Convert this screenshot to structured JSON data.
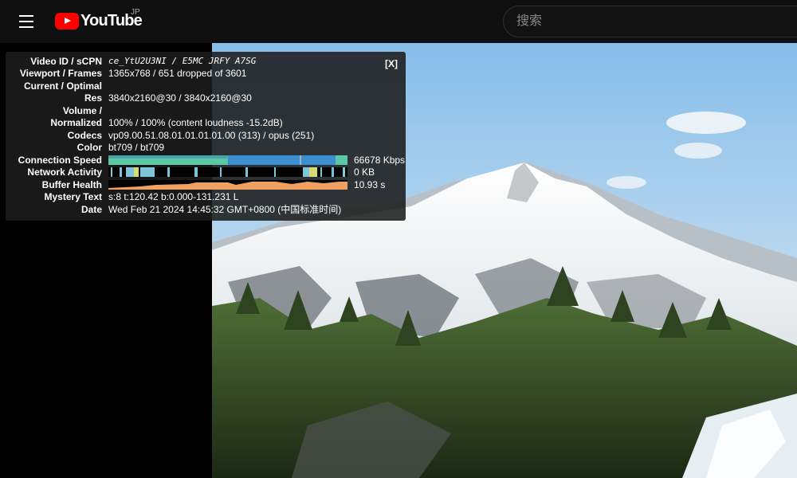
{
  "header": {
    "logo_text": "YouTube",
    "country_code": "JP",
    "search_placeholder": "搜索"
  },
  "stats": {
    "close_label": "[X]",
    "rows": {
      "video_id": {
        "label": "Video ID / sCPN",
        "value": "ce_YtU2U3NI / E5MC JRFY A7SG"
      },
      "viewport": {
        "label": "Viewport / Frames",
        "value": "1365x768 / 651 dropped of 3601"
      },
      "current_optimal": {
        "label": "Current / Optimal",
        "value": ""
      },
      "res": {
        "label": "Res",
        "value": "3840x2160@30 / 3840x2160@30"
      },
      "volume": {
        "label": "Volume /",
        "value": ""
      },
      "normalized": {
        "label": "Normalized",
        "value": "100% / 100% (content loudness -15.2dB)"
      },
      "codecs": {
        "label": "Codecs",
        "value": "vp09.00.51.08.01.01.01.01.00 (313) / opus (251)"
      },
      "color": {
        "label": "Color",
        "value": "bt709 / bt709"
      },
      "connection_speed": {
        "label": "Connection Speed",
        "value": "66678 Kbps"
      },
      "network_activity": {
        "label": "Network Activity",
        "value": "0 KB"
      },
      "buffer_health": {
        "label": "Buffer Health",
        "value": "10.93 s"
      },
      "mystery_text": {
        "label": "Mystery Text",
        "value": "s:8 t:120.42 b:0.000-131.231 L"
      },
      "date": {
        "label": "Date",
        "value": "Wed Feb 21 2024 14:45:32 GMT+0800 (中国标准时间)"
      }
    },
    "colors": {
      "connection_speed": "#3d8ed0",
      "connection_speed_alt": "#5cc7a4",
      "network_activity": "#7ec5d8",
      "network_activity_alt": "#d6d97a",
      "buffer_health": "#f0a060"
    }
  }
}
